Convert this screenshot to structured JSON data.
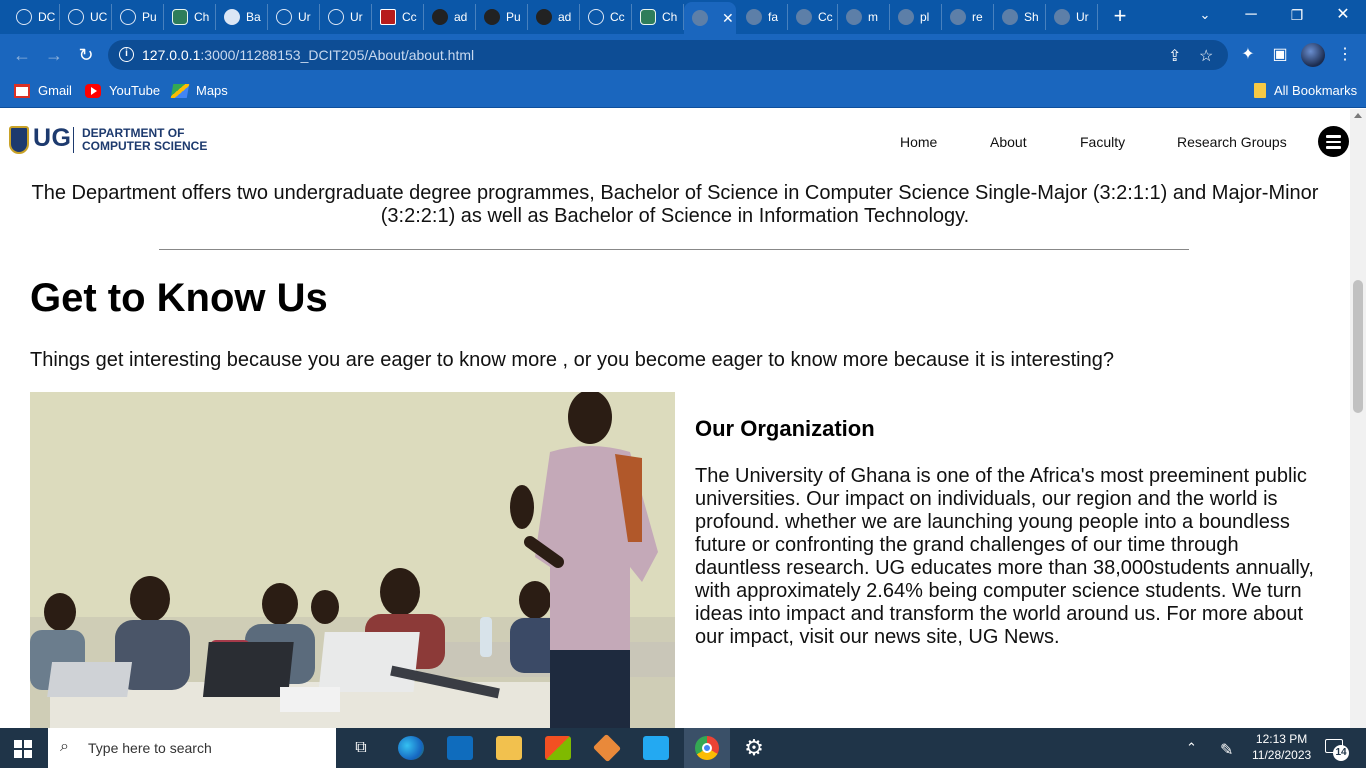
{
  "browser": {
    "tabs": [
      {
        "title": "DC",
        "icon": "globe-ring-icon"
      },
      {
        "title": "UC",
        "icon": "globe-ring-icon"
      },
      {
        "title": "Pu",
        "icon": "loading-ring-icon"
      },
      {
        "title": "Ch",
        "icon": "chatgpt-icon"
      },
      {
        "title": "Ba",
        "icon": "badge-icon"
      },
      {
        "title": "Ur",
        "icon": "globe-ring-icon"
      },
      {
        "title": "Ur",
        "icon": "globe-ring-icon"
      },
      {
        "title": "Cc",
        "icon": "crest-icon"
      },
      {
        "title": "ad",
        "icon": "github-icon"
      },
      {
        "title": "Pu",
        "icon": "github-icon"
      },
      {
        "title": "ad",
        "icon": "github-icon"
      },
      {
        "title": "Cc",
        "icon": "globe-ring-icon"
      },
      {
        "title": "Ch",
        "icon": "chatgpt-icon"
      },
      {
        "title": "",
        "icon": "globe-icon",
        "active": true
      },
      {
        "title": "fa",
        "icon": "globe-icon"
      },
      {
        "title": "Cc",
        "icon": "globe-icon"
      },
      {
        "title": "m",
        "icon": "globe-icon"
      },
      {
        "title": "pl",
        "icon": "globe-icon"
      },
      {
        "title": "re",
        "icon": "globe-icon"
      },
      {
        "title": "Sh",
        "icon": "globe-icon"
      },
      {
        "title": "Ur",
        "icon": "globe-icon"
      }
    ],
    "url_host": "127.0.0.1",
    "url_path": ":3000/11288153_DCIT205/About/about.html",
    "bookmarks": [
      {
        "label": "Gmail",
        "icon": "gmail-icon"
      },
      {
        "label": "YouTube",
        "icon": "youtube-icon"
      },
      {
        "label": "Maps",
        "icon": "maps-icon"
      }
    ],
    "all_bookmarks_label": "All Bookmarks"
  },
  "site": {
    "logo_ug": "UG",
    "logo_dept_line1": "DEPARTMENT OF",
    "logo_dept_line2": "COMPUTER SCIENCE",
    "nav": [
      "Home",
      "About",
      "Faculty",
      "Research Groups"
    ],
    "intro": "The Department offers two undergraduate degree programmes, Bachelor of Science in Computer Science Single-Major (3:2:1:1) and Major-Minor (3:2:2:1) as well as Bachelor of Science in Information Technology.",
    "heading": "Get to Know Us",
    "tagline": "Things get interesting because you are eager to know more , or you become eager to know more because it is interesting?",
    "org_heading": "Our Organization",
    "org_text": "The University of Ghana is one of the Africa's most preeminent public universities. Our impact on individuals, our region and the world is profound. whether we are launching young people into a boundless future or confronting the grand challenges of our time through dauntless research. UG educates more than 38,000students annually, with approximately 2.64% being computer science students. We turn ideas into impact and transform the world around us. For more about our impact, visit our news site, UG News."
  },
  "taskbar": {
    "search_placeholder": "Type here to search",
    "time": "12:13 PM",
    "date": "11/28/2023",
    "notification_count": "14",
    "apps": [
      "task-view-icon",
      "edge-icon",
      "mail-icon",
      "file-explorer-icon",
      "store-icon",
      "git-icon",
      "vscode-icon",
      "chrome-icon",
      "settings-icon"
    ]
  },
  "colors": {
    "tabstrip": "#0b57a8",
    "toolbar": "#1a66be",
    "ug_navy": "#1d3a6e",
    "taskbar": "#1f3448"
  }
}
